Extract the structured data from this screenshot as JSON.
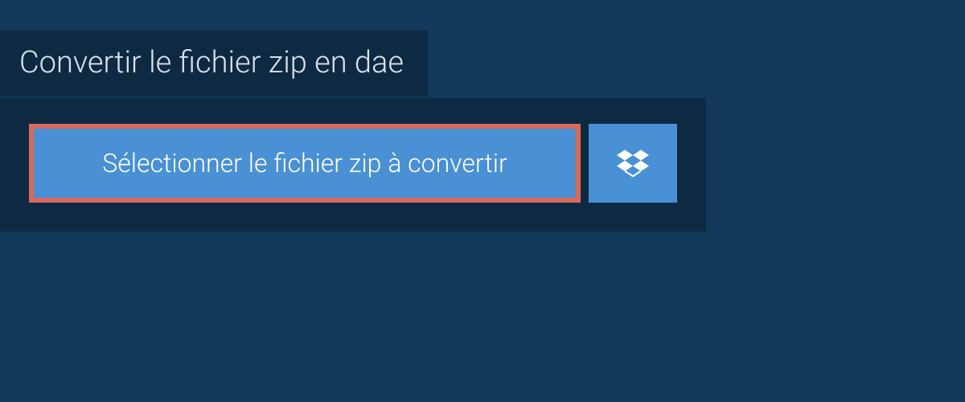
{
  "header": {
    "title": "Convertir le fichier zip en dae"
  },
  "upload": {
    "select_label": "Sélectionner le fichier zip à convertir",
    "dropbox_icon": "dropbox"
  },
  "colors": {
    "bg_main": "#13395a",
    "bg_panel": "#0e2a42",
    "button_blue": "#4990d4",
    "highlight_border": "#d9695b",
    "text_light": "#d9e3ec"
  }
}
